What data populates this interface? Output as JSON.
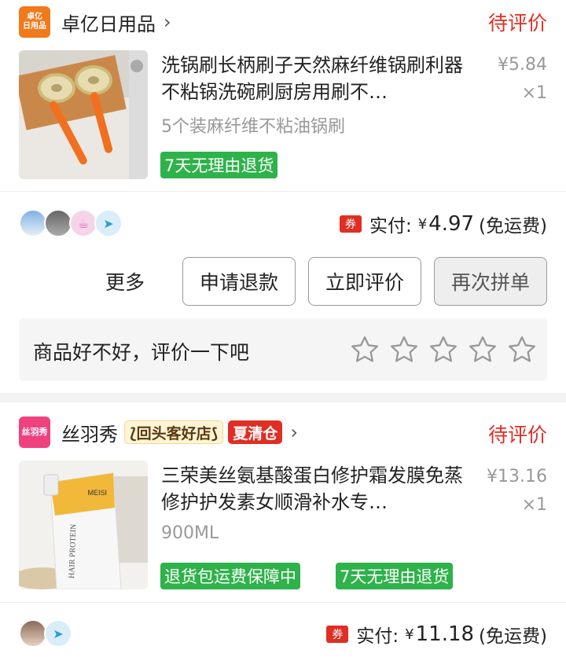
{
  "orders": [
    {
      "shop_logo_text": "卓亿\n日用品",
      "shop_name": "卓亿日用品",
      "status": "待评价",
      "title": "洗锅刷长柄刷子天然麻纤维锅刷利器不粘锅洗碗刷厨房用刷不…",
      "spec": "5个装麻纤维不粘油锅刷",
      "price": "¥5.84",
      "qty": "×1",
      "tags": [
        "7天无理由退货"
      ],
      "coupon": "券",
      "paid_label": "实付:",
      "currency": "¥",
      "paid_amount": "4.97",
      "shipping": "(免运费)",
      "actions": {
        "more": "更多",
        "refund": "申请退款",
        "review": "立即评价",
        "rebuy": "再次拼单"
      },
      "review_prompt": "商品好不好，评价一下吧"
    },
    {
      "shop_logo_text": "丝羽秀",
      "shop_name": "丝羽秀",
      "badge_return": "⟅回头客好店⟆",
      "badge_sale": "夏清仓",
      "status": "待评价",
      "title": "三荣美丝氨基酸蛋白修护霜发膜免蒸修护护发素女顺滑补水专…",
      "spec": "900ML",
      "price": "¥13.16",
      "qty": "×1",
      "tags": [
        "退货包运费保障中",
        "7天无理由退货"
      ],
      "coupon": "券",
      "paid_label": "实付:",
      "currency": "¥",
      "paid_amount": "11.18",
      "shipping": "(免运费)"
    }
  ],
  "product_image_text": {
    "brand": "MEISI",
    "label": "HAIR PROTEIN"
  },
  "colors": {
    "accent_red": "#e02e24",
    "tag_green": "#2eb24a",
    "shop_orange": "#f07a1c",
    "shop_pink": "#f0417f"
  }
}
